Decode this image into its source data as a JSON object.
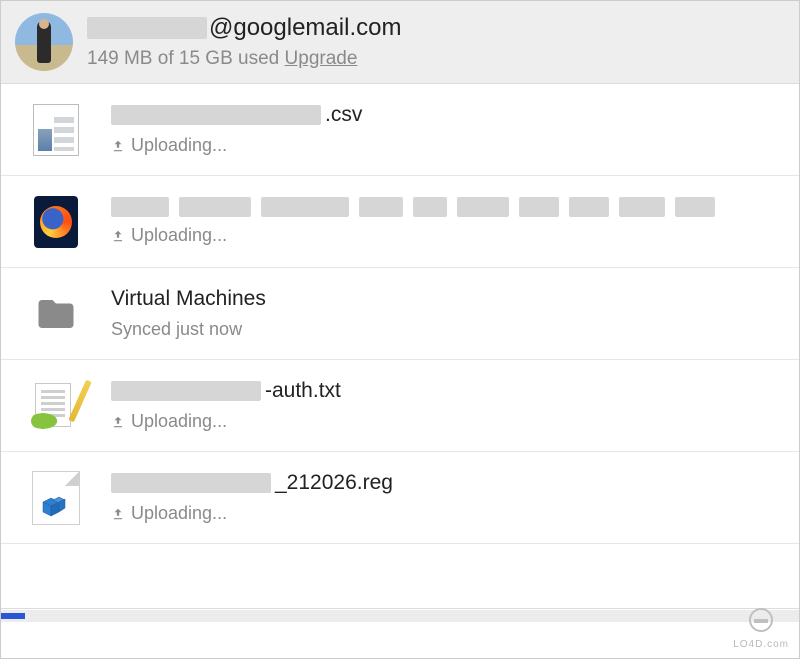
{
  "header": {
    "email_suffix": "@googlemail.com",
    "storage_used": "149 MB",
    "storage_total": "15 GB",
    "storage_text_template": "{used} of {total} used",
    "upgrade_label": "Upgrade"
  },
  "status_labels": {
    "uploading": "Uploading...",
    "synced_now": "Synced just now"
  },
  "files": [
    {
      "name_redacted": true,
      "name_suffix": ".csv",
      "icon": "csv-sheet",
      "status": "uploading"
    },
    {
      "name_redacted": true,
      "name_suffix": "",
      "icon": "firefox",
      "status": "uploading"
    },
    {
      "name_redacted": false,
      "name": "Virtual Machines",
      "icon": "folder",
      "status": "synced_now"
    },
    {
      "name_redacted": true,
      "name_suffix": "-auth.txt",
      "icon": "notepadpp",
      "status": "uploading"
    },
    {
      "name_redacted": true,
      "name_suffix": "_212026.reg",
      "icon": "registry",
      "status": "uploading"
    }
  ],
  "progress_percent": 3,
  "watermark": "LO4D.com"
}
